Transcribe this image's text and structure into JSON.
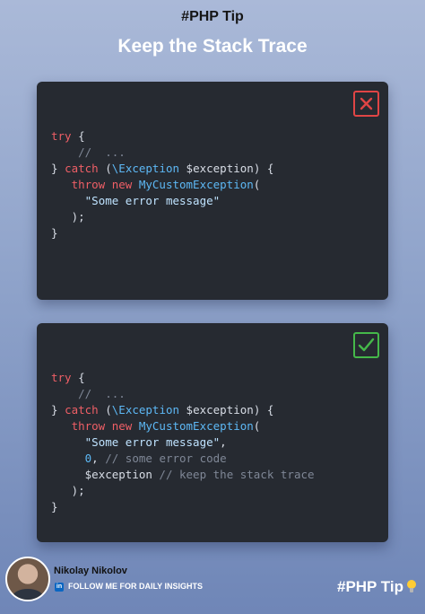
{
  "header": {
    "tag": "#PHP Tip",
    "title": "Keep the Stack Trace"
  },
  "bad_example": {
    "status_icon": "x-mark-icon",
    "status_color": "#e04545",
    "lines": {
      "l1_kw": "try",
      "l1_rest": " {",
      "l2_comment": "//  ...",
      "l3_open": "} ",
      "l3_kw": "catch",
      "l3_paren": " (",
      "l3_class": "\\Exception",
      "l3_var": " $exception",
      "l3_close": ") {",
      "l4_kw": "throw new",
      "l4_class": " MyCustomException",
      "l4_paren": "(",
      "l5_str": "\"Some error message\"",
      "l6": ");",
      "l7": "}"
    }
  },
  "good_example": {
    "status_icon": "check-mark-icon",
    "status_color": "#45b84a",
    "lines": {
      "l1_kw": "try",
      "l1_rest": " {",
      "l2_comment": "//  ...",
      "l3_open": "} ",
      "l3_kw": "catch",
      "l3_paren": " (",
      "l3_class": "\\Exception",
      "l3_var": " $exception",
      "l3_close": ") {",
      "l4_kw": "throw new",
      "l4_class": " MyCustomException",
      "l4_paren": "(",
      "l5_str": "\"Some error message\"",
      "l5_comma": ",",
      "l6_num": "0",
      "l6_comma": ", ",
      "l6_comment": "// some error code",
      "l7_var": "$exception",
      "l7_comment": " // keep the stack trace",
      "l8": ");",
      "l9": "}"
    }
  },
  "footer": {
    "author": "Nikolay Nikolov",
    "linkedin_icon_text": "in",
    "follow": "FOLLOW ME FOR DAILY INSIGHTS",
    "brand": "#PHP Tip",
    "brand_icon": "lightbulb-icon"
  }
}
